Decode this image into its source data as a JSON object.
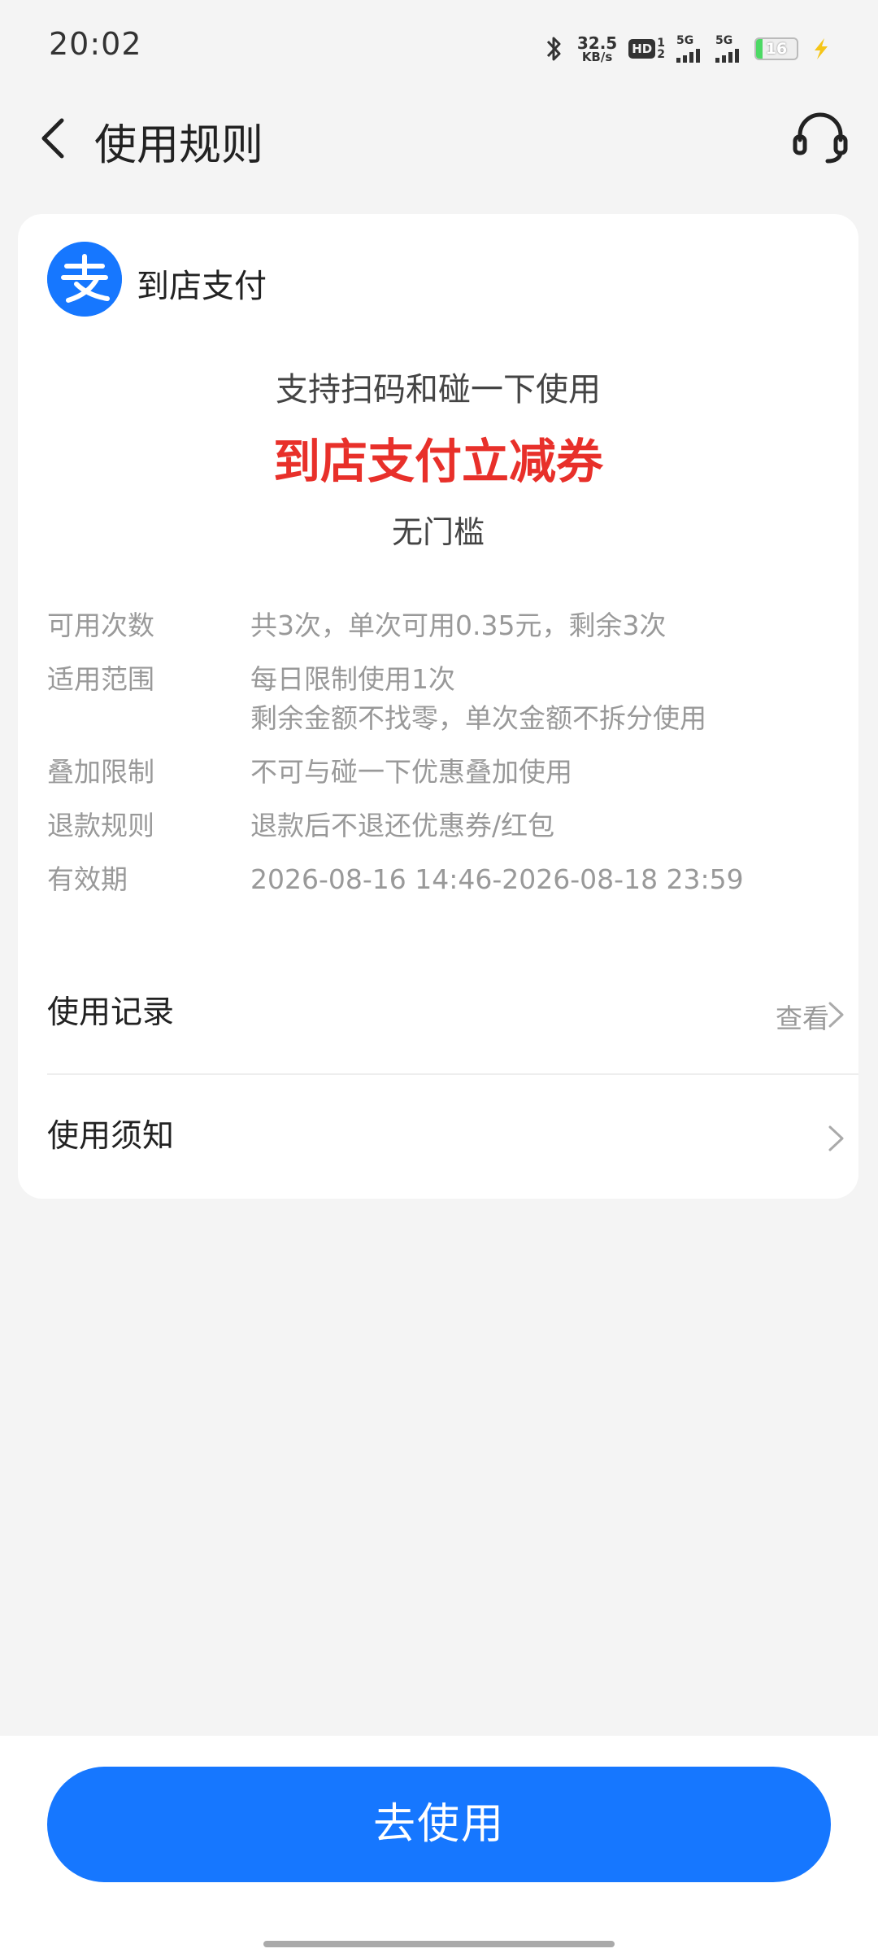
{
  "status_bar": {
    "time": "20:02",
    "net_speed_value": "32.5",
    "net_speed_unit": "KB/s",
    "hd_label": "HD",
    "hd_sims": "1",
    "hd_sims2": "2",
    "sim1_gen": "5G",
    "sim2_gen": "5G",
    "battery_level": "16",
    "icons": [
      "bluetooth-icon",
      "hd-voice-icon",
      "signal-icon",
      "battery-icon",
      "charging-icon"
    ],
    "battery_fill_fraction": 0.16
  },
  "header": {
    "title": "使用规则",
    "back_icon": "chevron-left-icon",
    "support_icon": "headset-icon"
  },
  "card": {
    "brand_logo_icon": "alipay-logo-icon",
    "brand_name": "到店支付",
    "subtitle": "支持扫码和碰一下使用",
    "coupon_title": "到店支付立减券",
    "threshold": "无门槛",
    "rules": [
      {
        "label": "可用次数",
        "value": "共3次，单次可用0.35元，剩余3次"
      },
      {
        "label": "适用范围",
        "value": "每日限制使用1次",
        "value2": "剩余金额不找零，单次金额不拆分使用"
      },
      {
        "label": "叠加限制",
        "value": "不可与碰一下优惠叠加使用"
      },
      {
        "label": "退款规则",
        "value": "退款后不退还优惠券/红包"
      },
      {
        "label": "有效期",
        "value": "2026-08-16 14:46-2026-08-18 23:59"
      }
    ],
    "usage_record": {
      "label": "使用记录",
      "action": "查看"
    },
    "usage_notes": {
      "label": "使用须知"
    }
  },
  "bottom": {
    "button_label": "去使用"
  },
  "colors": {
    "accent_blue": "#1677ff",
    "coupon_red": "#e8302a",
    "background": "#f4f4f4"
  }
}
